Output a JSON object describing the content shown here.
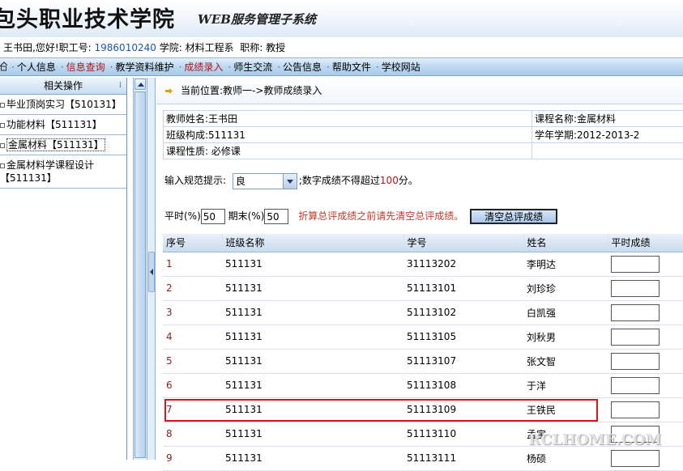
{
  "header": {
    "school_name": "包头职业技术学院",
    "system_name": "WEB服务管理子系统"
  },
  "userbar": {
    "greeting": "王书田,您好!",
    "staff_label": "职工号:",
    "staff_id": "1986010240",
    "college_label": "学院:",
    "college": "材料工程系",
    "title_label": "职称:",
    "title": "教授"
  },
  "nav": {
    "items": [
      {
        "label": "个人信息",
        "active": false
      },
      {
        "label": "信息查询",
        "active": true
      },
      {
        "label": "教学资料维护",
        "active": false
      },
      {
        "label": "成绩录入",
        "active": true
      },
      {
        "label": "师生交流",
        "active": false
      },
      {
        "label": "公告信息",
        "active": false
      },
      {
        "label": "帮助文件",
        "active": false
      },
      {
        "label": "学校网站",
        "active": false
      }
    ]
  },
  "sidebar": {
    "title": "相关操作",
    "items": [
      {
        "label": "毕业顶岗实习【510131】"
      },
      {
        "label": "功能材料【511131】"
      },
      {
        "label": "金属材料【511131】"
      },
      {
        "label": "金属材料学课程设计【511131】"
      }
    ]
  },
  "location": {
    "text": "当前位置:教师一->教师成绩录入"
  },
  "info": {
    "teacher": "教师姓名:王书田",
    "course": "课程名称:金属材料",
    "class": "班级构成:511131",
    "term": "学年学期:2012-2013-2",
    "nature": "课程性质: 必修课"
  },
  "entry": {
    "tip_label": "输入规范提示:",
    "grade_selected": "良",
    "tip_text_pre": ";数字成绩不得超过",
    "tip_max": "100",
    "tip_text_post": "分。",
    "usual_label": "平时(%)",
    "usual_value": "50",
    "final_label": "期末(%)",
    "final_value": "50",
    "warning": "折算总评成绩之前请先清空总评成绩。",
    "clear_button": "清空总评成绩"
  },
  "grid": {
    "headers": [
      "序号",
      "班级名称",
      "学号",
      "姓名",
      "平时成绩"
    ],
    "rows": [
      {
        "no": "1",
        "class": "511131",
        "id": "31113202",
        "name": "李明达"
      },
      {
        "no": "2",
        "class": "511131",
        "id": "51113101",
        "name": "刘珍珍"
      },
      {
        "no": "3",
        "class": "511131",
        "id": "51113102",
        "name": "白凯强"
      },
      {
        "no": "4",
        "class": "511131",
        "id": "51113105",
        "name": "刘秋男"
      },
      {
        "no": "5",
        "class": "511131",
        "id": "51113107",
        "name": "张文智"
      },
      {
        "no": "6",
        "class": "511131",
        "id": "51113108",
        "name": "于洋"
      },
      {
        "no": "7",
        "class": "511131",
        "id": "51113109",
        "name": "王铁民"
      },
      {
        "no": "8",
        "class": "511131",
        "id": "51113110",
        "name": "孟宇"
      },
      {
        "no": "9",
        "class": "511131",
        "id": "51113111",
        "name": "杨硕"
      }
    ]
  },
  "watermark": "RCLHOME.COM",
  "colors": {
    "nav_active": "#b0161d",
    "highlight_border": "#d9141e",
    "staff_id": "#1b57a8"
  }
}
